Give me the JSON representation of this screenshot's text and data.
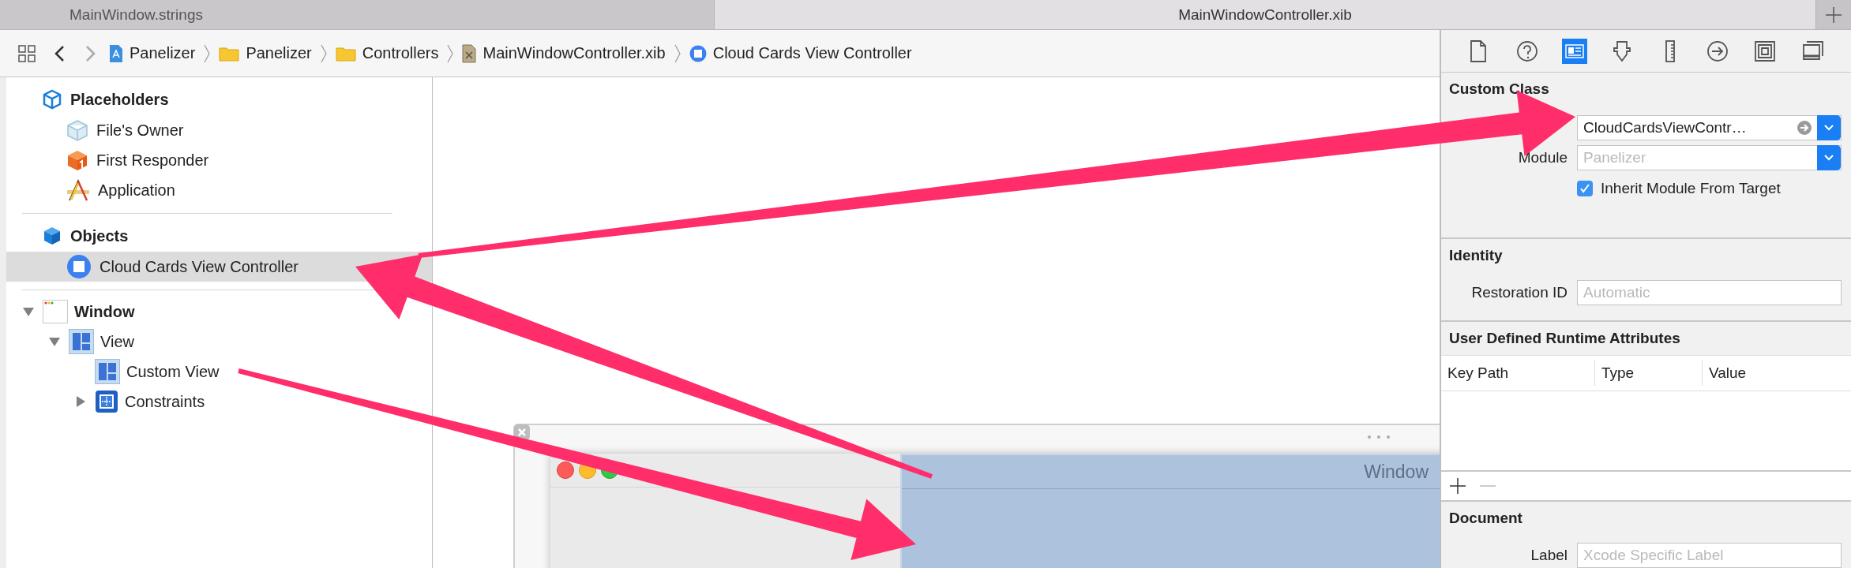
{
  "tabs": [
    {
      "label": "MainWindow.strings",
      "selected": false
    },
    {
      "label": "MainWindowController.xib",
      "selected": true
    }
  ],
  "breadcrumb": [
    {
      "label": "Panelizer",
      "kind": "project"
    },
    {
      "label": "Panelizer",
      "kind": "folder"
    },
    {
      "label": "Controllers",
      "kind": "folder"
    },
    {
      "label": "MainWindowController.xib",
      "kind": "xib"
    },
    {
      "label": "Cloud Cards View Controller",
      "kind": "controller"
    }
  ],
  "outline": {
    "sections": [
      {
        "title": "Placeholders",
        "kind": "placeholders",
        "items": [
          {
            "label": "File's Owner",
            "kind": "owner",
            "selected": false
          },
          {
            "label": "First Responder",
            "kind": "responder",
            "selected": false
          },
          {
            "label": "Application",
            "kind": "application",
            "selected": false
          }
        ]
      },
      {
        "title": "Objects",
        "kind": "objects",
        "items": [
          {
            "label": "Cloud Cards View Controller",
            "kind": "controller",
            "selected": true
          }
        ]
      }
    ],
    "tree": [
      {
        "label": "Window",
        "kind": "window",
        "expanded": true,
        "selected": false,
        "children": [
          {
            "label": "View",
            "kind": "view",
            "expanded": true,
            "selected": false,
            "children": [
              {
                "label": "Custom View",
                "kind": "view",
                "selected": false
              },
              {
                "label": "Constraints",
                "kind": "constraints",
                "expanded": false,
                "selected": false
              }
            ]
          }
        ]
      }
    ]
  },
  "canvas": {
    "window_title": "Window"
  },
  "inspector": {
    "tabs": [
      {
        "kind": "file",
        "selected": false
      },
      {
        "kind": "help",
        "selected": false
      },
      {
        "kind": "identity",
        "selected": true
      },
      {
        "kind": "attributes",
        "selected": false
      },
      {
        "kind": "size",
        "selected": false
      },
      {
        "kind": "connections",
        "selected": false
      },
      {
        "kind": "bindings",
        "selected": false
      },
      {
        "kind": "effects",
        "selected": false
      }
    ],
    "custom_class": {
      "title": "Custom Class",
      "class_value": "CloudCardsViewContr…",
      "module_label": "Module",
      "module_placeholder": "Panelizer",
      "inherit_label": "Inherit Module From Target",
      "inherit_checked": true
    },
    "identity": {
      "title": "Identity",
      "restoration_label": "Restoration ID",
      "restoration_placeholder": "Automatic"
    },
    "runtime": {
      "title": "User Defined Runtime Attributes",
      "columns": [
        "Key Path",
        "Type",
        "Value"
      ]
    },
    "document": {
      "title": "Document",
      "label_label": "Label",
      "label_placeholder": "Xcode Specific Label"
    }
  }
}
